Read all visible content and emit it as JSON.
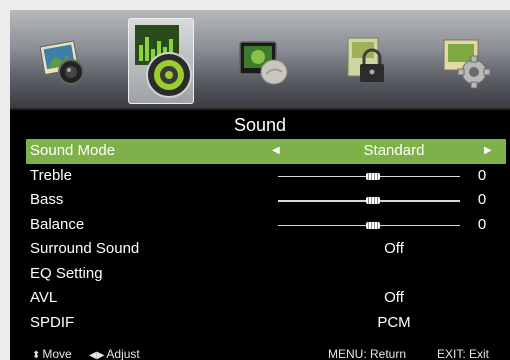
{
  "osd": {
    "title": "Sound",
    "tabs": [
      {
        "name": "picture",
        "icon": "picture-icon"
      },
      {
        "name": "sound",
        "icon": "sound-icon",
        "selected": true
      },
      {
        "name": "tv",
        "icon": "tv-icon"
      },
      {
        "name": "lock",
        "icon": "lock-icon"
      },
      {
        "name": "setup",
        "icon": "setup-icon"
      }
    ],
    "menu": [
      {
        "label": "Sound Mode",
        "value": "Standard",
        "selected": true
      },
      {
        "label": "Treble",
        "value": "0",
        "level": 0.52
      },
      {
        "label": "Bass",
        "value": "0",
        "level": 0.52
      },
      {
        "label": "Balance",
        "value": "0",
        "level": 0.52
      },
      {
        "label": "Surround Sound",
        "value": "Off"
      },
      {
        "label": "EQ Setting"
      },
      {
        "label": "AVL",
        "value": "Off"
      },
      {
        "label": "SPDIF",
        "value": "PCM"
      }
    ],
    "footer": {
      "move": "Move",
      "adjust": "Adjust",
      "return": "MENU: Return",
      "exit": "EXIT: Exit"
    },
    "colors": {
      "highlight": "#7fb14b",
      "background": "#000000",
      "text": "#ffffff"
    }
  }
}
